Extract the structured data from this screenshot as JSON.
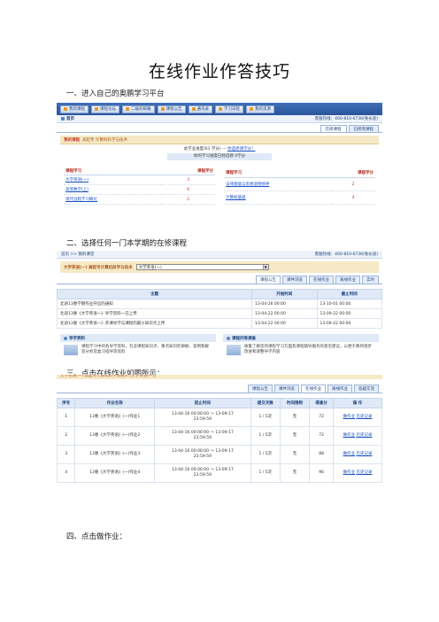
{
  "title": "在线作业作答技巧",
  "steps": [
    "一、进入自己的奥鹏学习平台",
    "二、选择任何一门本学期的在修课程",
    "三、点击在线作业如图所示：",
    "四、点击做作业："
  ],
  "shot1": {
    "nav": [
      "我的课程",
      "课程论坛",
      "二级的邮箱",
      "课程公告",
      "通讯录",
      "学习日程",
      "我的资源"
    ],
    "crumb_home": "首页",
    "hotline": "客服热线：400-810-6736(免长途)",
    "tabs": [
      "在修课程",
      "已修完课程"
    ],
    "my_course_label": "我的课程",
    "my_course_text": "高起专 计算机科学与技术",
    "progress_main": "总学业进度(61 学分) —",
    "progress_link": "你选修课学分！",
    "progress_sub": "你的学习进度已经选修 0学分",
    "col_course": "课程学习",
    "col_credit": "课程学分",
    "left_courses": [
      {
        "name": "大学英语(一)",
        "credit": "3"
      },
      {
        "name": "高等数学(上)",
        "credit": "6"
      },
      {
        "name": "现代远程学习概论",
        "credit": "2"
      }
    ],
    "right_courses": [
      {
        "name": "法律基础与思想道德修养",
        "credit": "2"
      },
      {
        "name": "计算机基础",
        "credit": "4"
      }
    ]
  },
  "shot2": {
    "crumb": "首页 >> 我的课堂",
    "hotline": "客服热线：400-810-6736(免长途)",
    "course_label": "大学英语(一) 高起专计算机科学与技术",
    "select_value": "大学英语(一)",
    "tabs": [
      "课程公告",
      "课件浏览",
      "在线作业",
      "离线作业",
      "实时"
    ],
    "headers": [
      "主题",
      "开始时间",
      "截止时间"
    ],
    "rows": [
      {
        "topic": "北语13春学期作业开启的通知",
        "start": "13-04-26 00:00",
        "end": "13-10-01 00:00"
      },
      {
        "topic": "北语13春《大学英语一》导学资料一已上传",
        "start": "13-04-22 00:00",
        "end": "13-09-22 00:00"
      },
      {
        "topic": "北语13春《大学英语一》开课导学与课程的最十知识点上传",
        "start": "13-04-22 00:00",
        "end": "13-09-22 00:00"
      }
    ],
    "panel_left_title": "导学资料",
    "panel_left_text": "课程学习中的各导学资料，包含课程知识点、重点知识的讲解、案例和解答分析及复习指导等资料",
    "panel_right_title": "课程问卷调查",
    "panel_right_text": "收集了解您的课程学习方面及课程辅导服务的意见建议，以便于教师逐步改进和调整导学内容"
  },
  "shot3": {
    "clip": "大学英语(一) 高起专计算机科学与技术 [大学英语(一)]",
    "tabs": [
      "课程公告",
      "课件浏览",
      "在线作业",
      "离线作业",
      "答疑交流"
    ],
    "headers": [
      "序号",
      "作业名称",
      "起止时间",
      "提交次数",
      "时间限制",
      "得高分",
      "操 作"
    ],
    "rows": [
      {
        "no": "1",
        "name": "13春《大学英语》(一)作业1",
        "time1": "13-04-16 00:00:00 ～ 13-09-17",
        "time2": "23:59:59",
        "count": "1 / 5次",
        "limit": "无",
        "score": "72",
        "op1": "做作业",
        "op2": "历史记录"
      },
      {
        "no": "2",
        "name": "13春《大学英语》(一)作业2",
        "time1": "13-04-16 00:00:00 ～ 13-09-17",
        "time2": "23:59:59",
        "count": "1 / 5次",
        "limit": "无",
        "score": "72",
        "op1": "做作业",
        "op2": "历史记录"
      },
      {
        "no": "3",
        "name": "13春《大学英语》(一)作业3",
        "time1": "13-04-16 00:00:00 ～ 13-09-17",
        "time2": "23:59:59",
        "count": "1 / 5次",
        "limit": "无",
        "score": "88",
        "op1": "做作业",
        "op2": "历史记录"
      },
      {
        "no": "4",
        "name": "13春《大学英语》(一)作业4",
        "time1": "13-04-16 00:00:00 ～ 13-09-17",
        "time2": "23:59:59",
        "count": "1 / 5次",
        "limit": "无",
        "score": "96",
        "op1": "做作业",
        "op2": "历史记录"
      }
    ]
  }
}
